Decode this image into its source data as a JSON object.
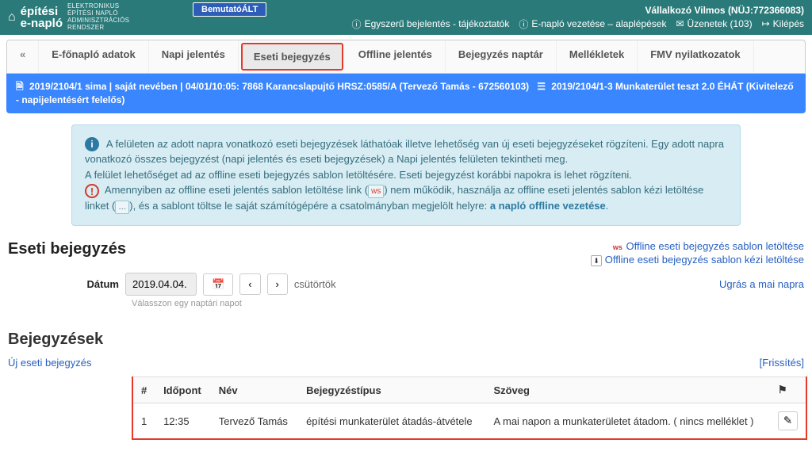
{
  "header": {
    "logo_main": "építési",
    "logo_sub": "e-napló",
    "logo_lines": "ELEKTRONIKUS\nÉPÍTÉSI NAPLÓ\nADMINISZTRÁCIÓS\nRENDSZER",
    "demo_badge": "BemutatóÁLT",
    "user": "Vállalkozó Vilmos",
    "user_id": "(NÜJ:772366083)",
    "link_simple": "Egyszerű bejelentés - tájékoztatók",
    "link_guide": "E-napló vezetése – alaplépések",
    "link_messages": "Üzenetek (103)",
    "link_logout": "Kilépés"
  },
  "tabs": {
    "back": "«",
    "t1": "E-főnapló adatok",
    "t2": "Napi jelentés",
    "t3": "Eseti bejegyzés",
    "t4": "Offline jelentés",
    "t5": "Bejegyzés naptár",
    "t6": "Mellékletek",
    "t7": "FMV nyilatkozatok"
  },
  "breadcrumb": {
    "left": "2019/2104/1 sima | saját nevében | 04/01/10:05: 7868 Karancslapujtő HRSZ:0585/A (Tervező Tamás - 672560103)",
    "right": "2019/2104/1-3 Munkaterület teszt 2.0 ÉHÁT (Kivitelező - napijelentésért felelős)"
  },
  "info": {
    "line1": "A felületen az adott napra vonatkozó eseti bejegyzések láthatóak illetve lehetőség van új eseti bejegyzéseket rögzíteni. Egy adott napra vonatkozó összes bejegyzést (napi jelentés és eseti bejegyzések) a Napi jelentés felületen tekintheti meg.",
    "line2": "A felület lehetőséget ad az offline eseti bejegyzés sablon letöltésére. Eseti bejegyzést korábbi napokra is lehet rögzíteni.",
    "line3a": "Amennyiben az offline eseti jelentés sablon letöltése link (",
    "line3_btn": "ws",
    "line3b": ") nem működik, használja az offline eseti jelentés sablon kézi letöltése linket (",
    "line3_btn2": "…",
    "line3c": "), és a sablont töltse le saját számítógépére a csatolmányban megjelölt helyre: ",
    "line3_link": "a napló offline vezetése",
    "line3d": "."
  },
  "section": {
    "title": "Eseti bejegyzés",
    "dl1": "Offline eseti bejegyzés sablon letöltése",
    "dl2": "Offline eseti bejegyzés sablon kézi letöltése",
    "date_label": "Dátum",
    "date_value": "2019.04.04.",
    "day_name": "csütörtök",
    "jump": "Ugrás a mai napra",
    "helper": "Válasszon egy naptári napot"
  },
  "entries": {
    "title": "Bejegyzések",
    "new_link": "Új eseti bejegyzés",
    "refresh": "[Frissítés]",
    "cols": {
      "num": "#",
      "time": "Időpont",
      "name": "Név",
      "type": "Bejegyzéstípus",
      "text": "Szöveg",
      "flag": "⚑"
    },
    "rows": [
      {
        "num": "1",
        "time": "12:35",
        "name": "Tervező Tamás",
        "type": "építési munkaterület átadás-átvétele",
        "text": "A mai napon a munkaterületet átadom. ( nincs melléklet )"
      }
    ]
  }
}
